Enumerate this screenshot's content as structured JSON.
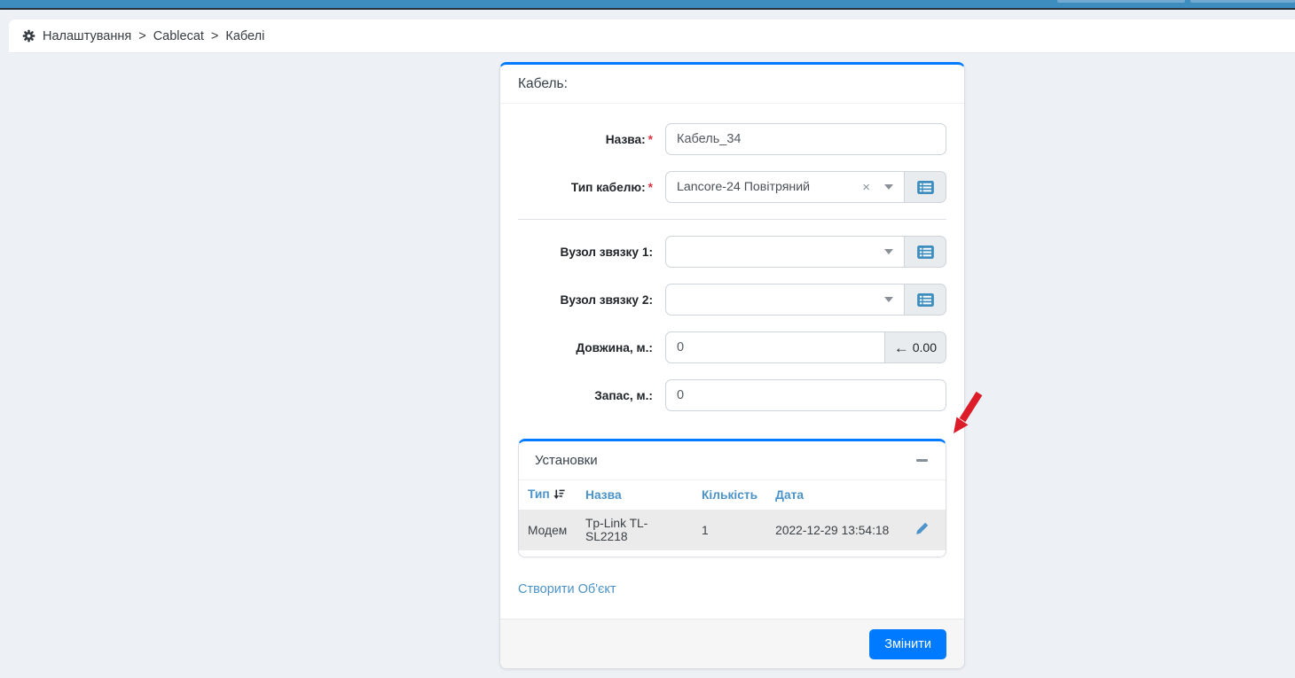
{
  "colors": {
    "navbar_blue": "#3d8ebf",
    "primary_blue": "#007bff",
    "table_header_blue": "#4b93c8",
    "annotation_red": "#dd1c2a",
    "required_red": "#dc3545"
  },
  "breadcrumb": {
    "home": "Налаштування",
    "app": "Cablecat",
    "page": "Кабелі",
    "sep1": ">",
    "sep2": ">"
  },
  "form": {
    "title": "Кабель:",
    "required_mark": "*",
    "name_label": "Назва:",
    "name_value": "Кабель_34",
    "type_label": "Тип кабелю:",
    "type_value": "Lancore-24 Повітряний",
    "clear_icon": "×",
    "node1_label": "Вузол звязку 1:",
    "node1_value": "",
    "node2_label": "Вузол звязку 2:",
    "node2_value": "",
    "length_label": "Довжина, м.:",
    "length_value": "0",
    "length_addon_arrow": "←",
    "length_addon_value": "0.00",
    "reserve_label": "Запас, м.:",
    "reserve_value": "0"
  },
  "installations": {
    "title": "Установки",
    "columns": [
      "Тип",
      "Назва",
      "Кількість",
      "Дата"
    ],
    "rows": [
      {
        "type": "Модем",
        "name": "Tp-Link TL-SL2218",
        "qty": "1",
        "date": "2022-12-29 13:54:18"
      }
    ]
  },
  "create_link_label": "Створити Об'єкт",
  "footer": {
    "submit_label": "Змінити"
  }
}
